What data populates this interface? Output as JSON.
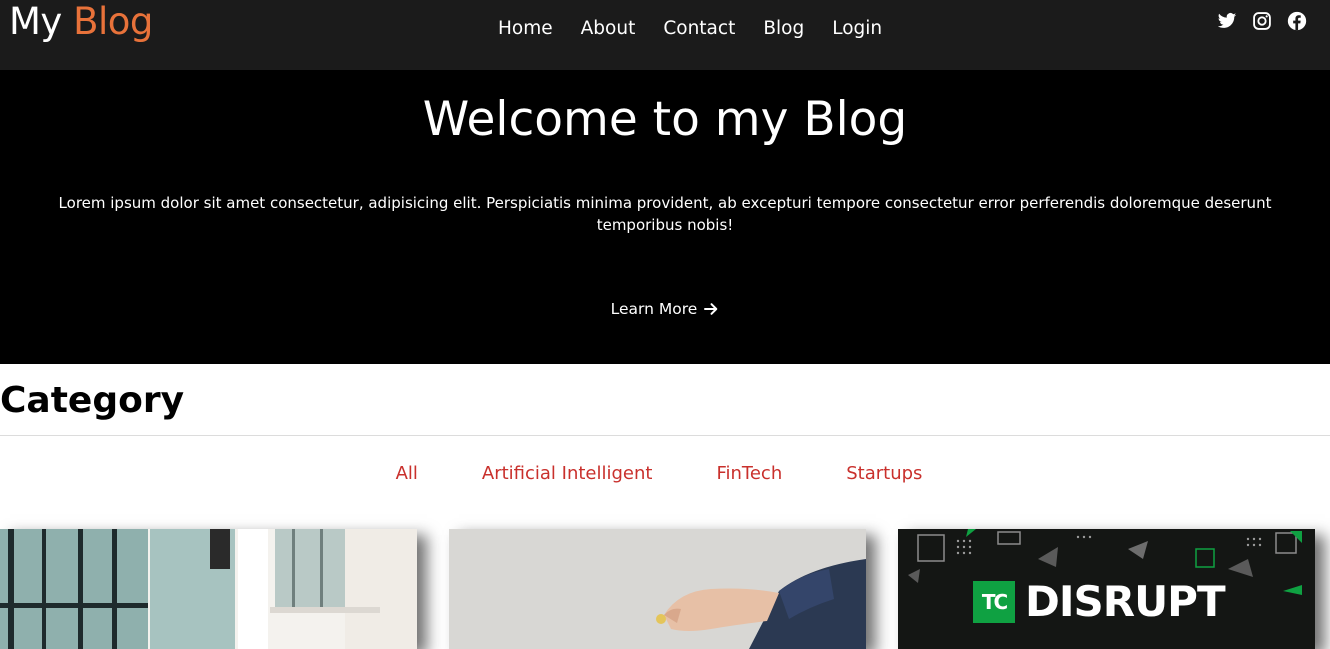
{
  "navbar": {
    "brand_prefix": "My",
    "brand_accent": "Blog",
    "links": [
      {
        "label": "Home"
      },
      {
        "label": "About"
      },
      {
        "label": "Contact"
      },
      {
        "label": "Blog"
      },
      {
        "label": "Login"
      }
    ],
    "social_icons": [
      "twitter-icon",
      "instagram-icon",
      "facebook-icon"
    ]
  },
  "hero": {
    "title": "Welcome to my Blog",
    "text": "Lorem ipsum dolor sit amet consectetur, adipisicing elit. Perspiciatis minima provident, ab excepturi tempore consectetur error perferendis doloremque deserunt temporibus nobis!",
    "cta_label": "Learn More",
    "cta_icon": "arrow-right-icon"
  },
  "category": {
    "title": "Category",
    "filters": [
      {
        "label": "All"
      },
      {
        "label": "Artificial Intelligent"
      },
      {
        "label": "FinTech"
      },
      {
        "label": "Startups"
      }
    ]
  },
  "cards": [
    {
      "image": "window-door-photo"
    },
    {
      "image": "hand-photo"
    },
    {
      "image": "disrupt-banner",
      "logo_mark": "TC",
      "logo_text": "DISRUPT"
    }
  ],
  "colors": {
    "navbar_bg": "#1b1b1b",
    "hero_bg": "#000000",
    "brand_accent": "#e8723a",
    "filter_link": "#c9302c",
    "disrupt_green": "#0fa142"
  }
}
